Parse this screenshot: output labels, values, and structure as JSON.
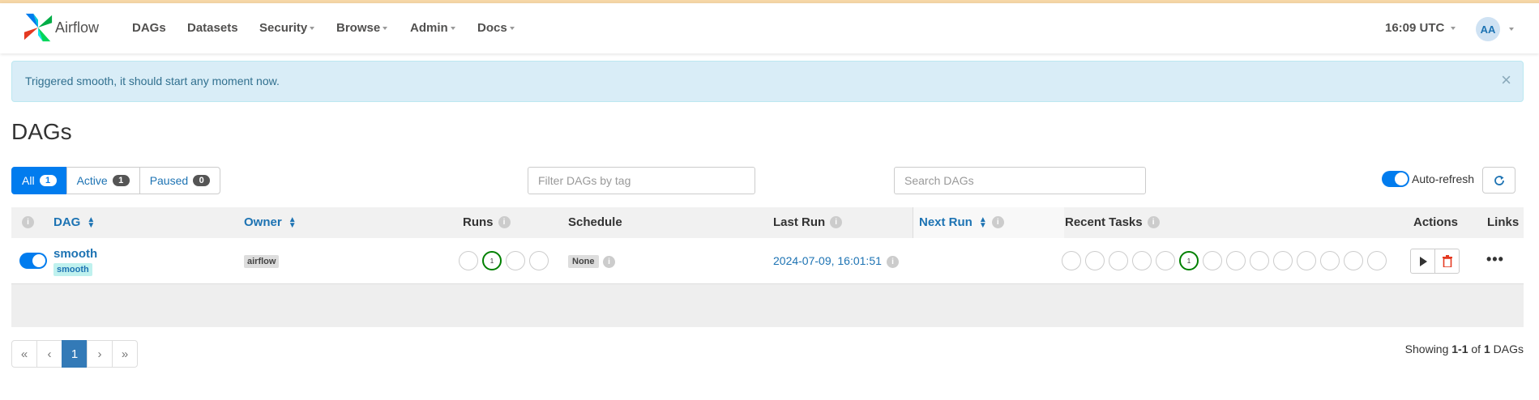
{
  "header": {
    "brand": "Airflow",
    "nav": [
      "DAGs",
      "Datasets",
      "Security",
      "Browse",
      "Admin",
      "Docs"
    ],
    "clock": "16:09 UTC",
    "avatar": "AA"
  },
  "alert": {
    "message": "Triggered smooth, it should start any moment now.",
    "close": "×"
  },
  "page_title": "DAGs",
  "filters": {
    "all_label": "All",
    "all_count": "1",
    "active_label": "Active",
    "active_count": "1",
    "paused_label": "Paused",
    "paused_count": "0",
    "tag_placeholder": "Filter DAGs by tag",
    "search_placeholder": "Search DAGs",
    "auto_refresh_label": "Auto-refresh"
  },
  "table": {
    "headers": {
      "dag": "DAG",
      "owner": "Owner",
      "runs": "Runs",
      "schedule": "Schedule",
      "last_run": "Last Run",
      "next_run": "Next Run",
      "recent_tasks": "Recent Tasks",
      "actions": "Actions",
      "links": "Links"
    },
    "rows": [
      {
        "dag_id": "smooth",
        "tag": "smooth",
        "owner": "airflow",
        "runs_count": "1",
        "schedule": "None",
        "last_run": "2024-07-09, 16:01:51",
        "recent_tasks_count": "1",
        "links": "•••"
      }
    ]
  },
  "pagination": {
    "first": "«",
    "prev": "‹",
    "page": "1",
    "next": "›",
    "last": "»"
  },
  "footer": {
    "prefix": "Showing ",
    "range": "1-1",
    "of": " of ",
    "total": "1",
    "suffix": " DAGs"
  },
  "colors": {
    "accent": "#017cee",
    "success": "#008000",
    "link": "#1d73b3",
    "alert_bg": "#d9edf7"
  }
}
